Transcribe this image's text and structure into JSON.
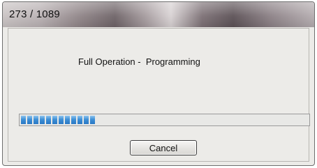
{
  "window": {
    "title": "273 / 1089"
  },
  "message": "Full Operation -  Programming",
  "progress": {
    "current": 273,
    "total": 1089,
    "fraction": 0.25,
    "color": "#3d8fd6"
  },
  "buttons": {
    "cancel_label": "Cancel"
  }
}
